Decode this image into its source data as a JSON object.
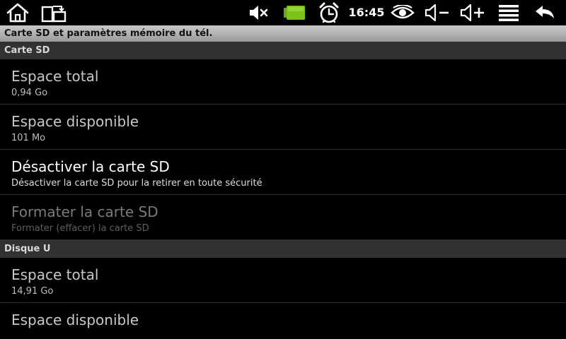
{
  "status_bar": {
    "time": "16:45",
    "icons": [
      "home-icon",
      "rotate-screen-icon",
      "mute-icon",
      "battery-icon",
      "alarm-icon",
      "eye-icon",
      "volume-down-icon",
      "volume-up-icon",
      "menu-icon",
      "back-icon"
    ],
    "battery_color": "#7cc217"
  },
  "header": {
    "title": "Carte SD et paramètres mémoire du tél."
  },
  "sections": {
    "sd_card": {
      "label": "Carte SD",
      "total": {
        "title": "Espace total",
        "value": "0,94 Go"
      },
      "available": {
        "title": "Espace disponible",
        "value": "101 Mo"
      },
      "unmount": {
        "title": "Désactiver la carte SD",
        "summary": "Désactiver la carte SD pour la retirer en toute sécurité"
      },
      "format": {
        "title": "Formater la carte SD",
        "summary": "Formater (effacer) la carte SD"
      }
    },
    "disk_u": {
      "label": "Disque U",
      "total": {
        "title": "Espace total",
        "value": "14,91 Go"
      },
      "available": {
        "title": "Espace disponible"
      }
    }
  }
}
